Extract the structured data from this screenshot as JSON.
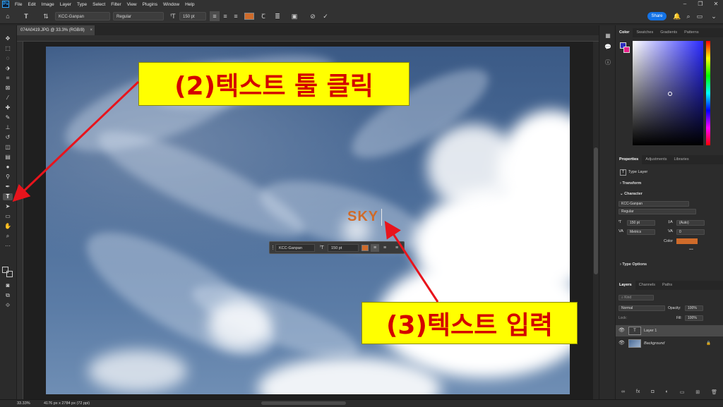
{
  "app": {
    "menu": [
      "File",
      "Edit",
      "Image",
      "Layer",
      "Type",
      "Select",
      "Filter",
      "View",
      "Plugins",
      "Window",
      "Help"
    ],
    "logo_text": "Ps"
  },
  "options_bar": {
    "font_family": "KCC-Ganpan",
    "font_style": "Regular",
    "font_size": "150 pt",
    "text_color": "#cf6b2a",
    "share_label": "Share"
  },
  "document": {
    "tab_title": "074A0419.JPG @ 33.3% (RGB/8)",
    "canvas_text": "SKY",
    "text_color": "#cf6b2a"
  },
  "context_bar": {
    "font_family": "KCC-Ganpan",
    "font_size": "150 pt"
  },
  "callouts": {
    "step2": "(2)텍스트 툴 클릭",
    "step3": "(3)텍스트 입력",
    "fill_color": "#ffff00",
    "text_color": "#d40000",
    "arrow_color": "#e8141c"
  },
  "status": {
    "zoom": "33.33%",
    "dimensions": "4176 px x 2784 px (72 ppi)"
  },
  "color_panel": {
    "tabs": [
      "Color",
      "Swatches",
      "Gradients",
      "Patterns"
    ],
    "foreground": "#2d2dbd",
    "background": "#e8208a"
  },
  "properties_panel": {
    "tabs": [
      "Properties",
      "Adjustments",
      "Libraries"
    ],
    "layer_kind": "Type Layer",
    "transform_label": "Transform",
    "character_label": "Character",
    "font_family": "KCC-Ganpan",
    "font_style": "Regular",
    "size": "150 pt",
    "leading": "(Auto)",
    "kerning": "Metrics",
    "tracking": "0",
    "color_label": "Color",
    "type_options_label": "Type Options",
    "more": "•••"
  },
  "layers_panel": {
    "tabs": [
      "Layers",
      "Channels",
      "Paths"
    ],
    "search_placeholder": "Kind",
    "blend_mode": "Normal",
    "opacity_label": "Opacity:",
    "opacity": "100%",
    "lock_label": "Lock:",
    "fill_label": "Fill:",
    "fill": "100%",
    "layers": [
      {
        "name": "Layer 1",
        "thumb": "T"
      },
      {
        "name": "Background",
        "thumb": ""
      }
    ]
  }
}
